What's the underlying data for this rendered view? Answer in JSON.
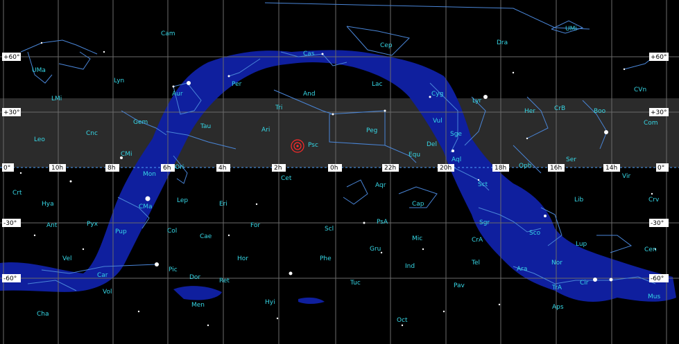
{
  "colors": {
    "background": "#000000",
    "milky_way": "#0f1f9e",
    "grid": "#6b6b6b",
    "band": "#2b2b2b",
    "constellation_line": "#4a86d8",
    "constellation_label": "#36d7e6",
    "equator": "#4fa3ff",
    "marker": "#ff2a2a"
  },
  "ra_labels": [
    "10h",
    "8h",
    "6h",
    "4h",
    "2h",
    "0h",
    "22h",
    "20h",
    "18h",
    "16h",
    "14h"
  ],
  "dec_labels": [
    "+60°",
    "+30°",
    "0°",
    "-30°",
    "-60°"
  ],
  "constellations": [
    "Cam",
    "UMi",
    "Dra",
    "UMa",
    "Cas",
    "Cep",
    "Lyn",
    "Per",
    "Lac",
    "CVn",
    "Aur",
    "And",
    "LMi",
    "Cyg",
    "Lyr",
    "Tri",
    "Her",
    "CrB",
    "Boo",
    "Gem",
    "Vul",
    "Tau",
    "Com",
    "Cnc",
    "Ari",
    "Peg",
    "Sge",
    "Leo",
    "CMi",
    "Psc",
    "Del",
    "Equ",
    "Ser",
    "Ori",
    "Aql",
    "Mon",
    "Oph",
    "Cet",
    "Aqr",
    "Sct",
    "Vir",
    "Crt",
    "Lep",
    "Eri",
    "Hya",
    "CMa",
    "Cap",
    "Lib",
    "Crv",
    "Ant",
    "Pyx",
    "For",
    "PsA",
    "Sgr",
    "Pup",
    "Col",
    "Scl",
    "Sco",
    "Cae",
    "Mic",
    "CrA",
    "Lup",
    "Cen",
    "Vel",
    "Hor",
    "Phe",
    "Gru",
    "Ind",
    "Tel",
    "Ara",
    "Nor",
    "Car",
    "Pic",
    "Dor",
    "Ret",
    "Tuc",
    "Pav",
    "TrA",
    "Cir",
    "Vol",
    "Men",
    "Hyi",
    "Aps",
    "Mus",
    "Cha",
    "Oct"
  ],
  "target_marker": "current-position-marker"
}
